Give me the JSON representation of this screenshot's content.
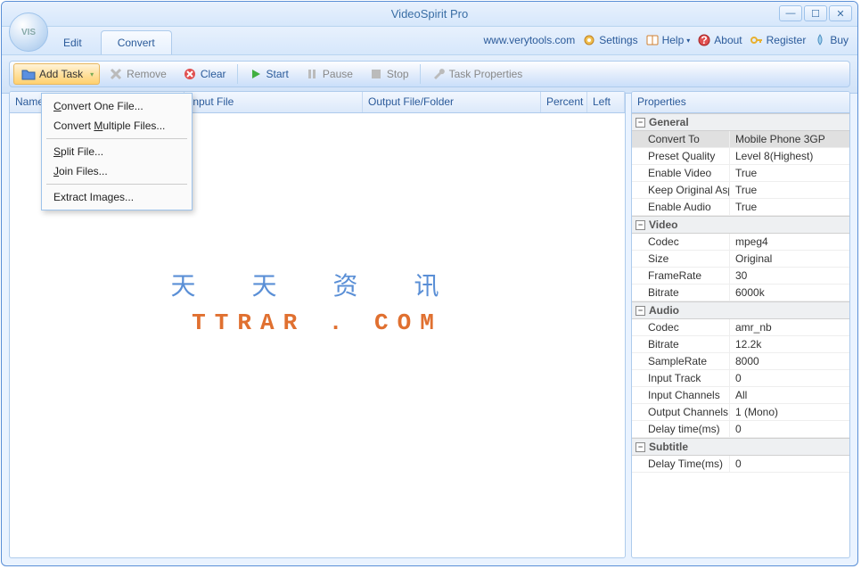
{
  "window": {
    "title": "VideoSpirit Pro"
  },
  "tabs": {
    "edit": "Edit",
    "convert": "Convert"
  },
  "toplinks": {
    "url": "www.verytools.com",
    "settings": "Settings",
    "help": "Help",
    "about": "About",
    "register": "Register",
    "buy": "Buy"
  },
  "toolbar": {
    "add": "Add Task",
    "remove": "Remove",
    "clear": "Clear",
    "start": "Start",
    "pause": "Pause",
    "stop": "Stop",
    "props": "Task Properties"
  },
  "dropdown": {
    "one": "Convert One File...",
    "multi": "Convert Multiple Files...",
    "split": "Split File...",
    "join": "Join Files...",
    "extract": "Extract Images..."
  },
  "columns": {
    "name": "Name",
    "input": "Input File",
    "output": "Output File/Folder",
    "percent": "Percent",
    "left": "Left"
  },
  "watermark": {
    "line1": "天 天 资 讯",
    "line2": "TTRAR . COM"
  },
  "properties": {
    "header": "Properties",
    "groups": {
      "general": "General",
      "video": "Video",
      "audio": "Audio",
      "subtitle": "Subtitle"
    },
    "general": {
      "convert_to_k": "Convert To",
      "convert_to_v": "Mobile Phone 3GP",
      "preset_k": "Preset Quality",
      "preset_v": "Level 8(Highest)",
      "envid_k": "Enable Video",
      "envid_v": "True",
      "aspect_k": "Keep Original Asp",
      "aspect_v": "True",
      "enaud_k": "Enable Audio",
      "enaud_v": "True"
    },
    "video": {
      "codec_k": "Codec",
      "codec_v": "mpeg4",
      "size_k": "Size",
      "size_v": "Original",
      "fr_k": "FrameRate",
      "fr_v": "30",
      "br_k": "Bitrate",
      "br_v": "6000k"
    },
    "audio": {
      "codec_k": "Codec",
      "codec_v": "amr_nb",
      "br_k": "Bitrate",
      "br_v": "12.2k",
      "sr_k": "SampleRate",
      "sr_v": "8000",
      "it_k": "Input Track",
      "it_v": "0",
      "ic_k": "Input Channels",
      "ic_v": "All",
      "oc_k": "Output Channels",
      "oc_v": "1 (Mono)",
      "dt_k": "Delay time(ms)",
      "dt_v": "0"
    },
    "subtitle": {
      "dt_k": "Delay Time(ms)",
      "dt_v": "0"
    }
  }
}
